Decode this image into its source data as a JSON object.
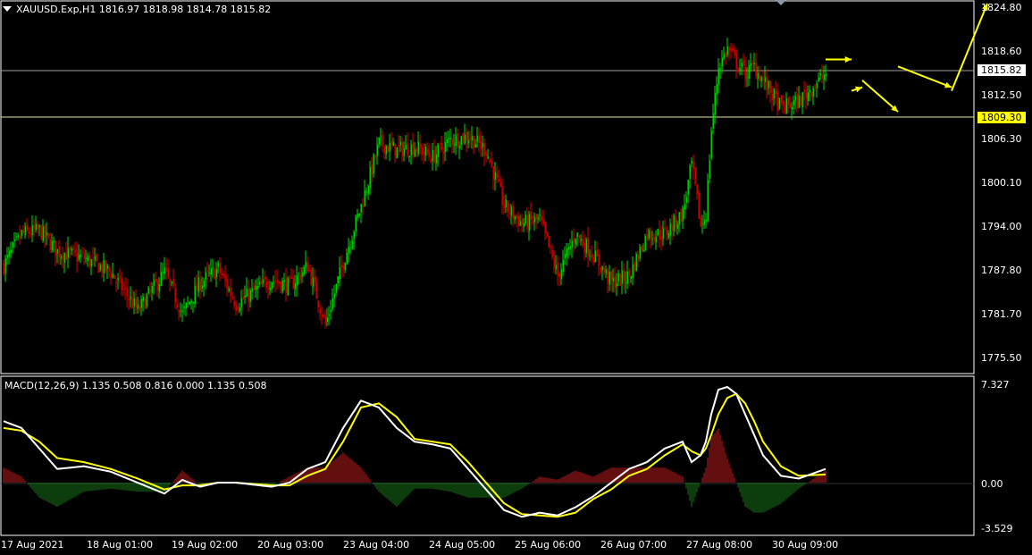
{
  "header": {
    "symbol": "XAUUSD.Exp,H1",
    "ohlc": "1816.97 1818.98 1814.78 1815.82",
    "title": "XAUUSD.Exp,H1  1816.97 1818.98 1814.78 1815.82"
  },
  "price_axis": {
    "ticks": [
      "1824.80",
      "1818.60",
      "1812.50",
      "1806.30",
      "1800.10",
      "1794.00",
      "1787.80",
      "1781.70",
      "1775.50"
    ],
    "current_price": "1815.82",
    "level_line": "1809.30"
  },
  "macd": {
    "title": "MACD(12,26,9) 1.135 0.508 0.816 0.000 1.135 0.508",
    "ticks": [
      "7.327",
      "0.00",
      "-3.529"
    ]
  },
  "time_axis": {
    "ticks": [
      "17 Aug 2021",
      "18 Aug 01:00",
      "19 Aug 02:00",
      "20 Aug 03:00",
      "23 Aug 04:00",
      "24 Aug 05:00",
      "25 Aug 06:00",
      "26 Aug 07:00",
      "27 Aug 08:00",
      "30 Aug 09:00"
    ]
  },
  "colors": {
    "background": "#000000",
    "bull": "#00e000",
    "bear": "#e00000",
    "grid_lines": "#ffffff",
    "forecast": "#ffff00",
    "macd_line": "#ffffff",
    "signal_line": "#ffff00",
    "histogram_up": "#c81e1e",
    "histogram_down": "#1a7a1a"
  },
  "chart_data": {
    "type": "candlestick",
    "symbol": "XAUUSD.Exp",
    "timeframe": "H1",
    "ylim": [
      1773.5,
      1826.0
    ],
    "price_anchors": [
      [
        0,
        1788.5
      ],
      [
        10,
        1793.0
      ],
      [
        20,
        1793.5
      ],
      [
        30,
        1790.5
      ],
      [
        45,
        1789.5
      ],
      [
        60,
        1787.5
      ],
      [
        75,
        1782.0
      ],
      [
        90,
        1787.5
      ],
      [
        100,
        1781.5
      ],
      [
        110,
        1786.0
      ],
      [
        120,
        1788.0
      ],
      [
        130,
        1783.0
      ],
      [
        150,
        1786.5
      ],
      [
        160,
        1785.5
      ],
      [
        170,
        1788.5
      ],
      [
        180,
        1780.0
      ],
      [
        190,
        1789.0
      ],
      [
        200,
        1797.0
      ],
      [
        210,
        1806.0
      ],
      [
        220,
        1805.0
      ],
      [
        230,
        1805.5
      ],
      [
        240,
        1804.0
      ],
      [
        250,
        1806.5
      ],
      [
        260,
        1807.0
      ],
      [
        270,
        1805.0
      ],
      [
        280,
        1797.0
      ],
      [
        290,
        1794.5
      ],
      [
        300,
        1795.0
      ],
      [
        310,
        1787.0
      ],
      [
        320,
        1793.0
      ],
      [
        330,
        1790.0
      ],
      [
        340,
        1786.0
      ],
      [
        350,
        1787.0
      ],
      [
        360,
        1793.0
      ],
      [
        370,
        1793.0
      ],
      [
        380,
        1796.0
      ],
      [
        385,
        1803.0
      ],
      [
        390,
        1794.0
      ],
      [
        393,
        1796.0
      ],
      [
        396,
        1808.0
      ],
      [
        400,
        1817.0
      ],
      [
        405,
        1819.5
      ],
      [
        410,
        1817.5
      ],
      [
        415,
        1816.0
      ],
      [
        420,
        1817.0
      ],
      [
        425,
        1815.0
      ],
      [
        435,
        1811.0
      ],
      [
        445,
        1812.0
      ],
      [
        460,
        1816.0
      ]
    ],
    "forecast_path": [
      [
        1818.0,
        1818.0
      ],
      [
        1813.5,
        1814.0
      ],
      [
        1815.0,
        1810.5
      ],
      [
        1817.0,
        1814.0
      ],
      [
        1813.5,
        1826.0
      ]
    ],
    "macd_anchors": [
      [
        0,
        4.5
      ],
      [
        10,
        4.0
      ],
      [
        20,
        2.5
      ],
      [
        30,
        1.0
      ],
      [
        45,
        1.2
      ],
      [
        60,
        0.8
      ],
      [
        75,
        0.0
      ],
      [
        90,
        -0.8
      ],
      [
        100,
        0.2
      ],
      [
        110,
        -0.3
      ],
      [
        120,
        0.0
      ],
      [
        130,
        0.0
      ],
      [
        150,
        -0.3
      ],
      [
        160,
        0.0
      ],
      [
        170,
        1.0
      ],
      [
        180,
        1.5
      ],
      [
        190,
        4.0
      ],
      [
        200,
        6.0
      ],
      [
        210,
        5.5
      ],
      [
        220,
        4.0
      ],
      [
        230,
        3.0
      ],
      [
        240,
        2.8
      ],
      [
        250,
        2.5
      ],
      [
        260,
        1.0
      ],
      [
        270,
        -0.5
      ],
      [
        280,
        -2.0
      ],
      [
        290,
        -2.5
      ],
      [
        300,
        -2.2
      ],
      [
        310,
        -2.4
      ],
      [
        320,
        -1.8
      ],
      [
        330,
        -1.0
      ],
      [
        340,
        0.0
      ],
      [
        350,
        1.0
      ],
      [
        360,
        1.5
      ],
      [
        370,
        2.5
      ],
      [
        380,
        3.0
      ],
      [
        385,
        1.5
      ],
      [
        390,
        2.0
      ],
      [
        393,
        3.0
      ],
      [
        396,
        5.0
      ],
      [
        400,
        6.8
      ],
      [
        405,
        7.0
      ],
      [
        410,
        6.5
      ],
      [
        415,
        5.0
      ],
      [
        420,
        3.5
      ],
      [
        425,
        2.0
      ],
      [
        435,
        0.5
      ],
      [
        445,
        0.3
      ],
      [
        460,
        1.0
      ]
    ],
    "signal_anchors": [
      [
        0,
        4.0
      ],
      [
        10,
        3.8
      ],
      [
        20,
        3.0
      ],
      [
        30,
        1.8
      ],
      [
        45,
        1.5
      ],
      [
        60,
        1.0
      ],
      [
        75,
        0.3
      ],
      [
        90,
        -0.5
      ],
      [
        100,
        -0.2
      ],
      [
        110,
        -0.2
      ],
      [
        120,
        0.0
      ],
      [
        130,
        0.0
      ],
      [
        150,
        -0.2
      ],
      [
        160,
        -0.2
      ],
      [
        170,
        0.5
      ],
      [
        180,
        1.0
      ],
      [
        190,
        3.0
      ],
      [
        200,
        5.5
      ],
      [
        210,
        5.8
      ],
      [
        220,
        4.8
      ],
      [
        230,
        3.2
      ],
      [
        240,
        3.0
      ],
      [
        250,
        2.8
      ],
      [
        260,
        1.5
      ],
      [
        270,
        0.0
      ],
      [
        280,
        -1.5
      ],
      [
        290,
        -2.3
      ],
      [
        300,
        -2.4
      ],
      [
        310,
        -2.5
      ],
      [
        320,
        -2.2
      ],
      [
        330,
        -1.2
      ],
      [
        340,
        -0.5
      ],
      [
        350,
        0.5
      ],
      [
        360,
        1.0
      ],
      [
        370,
        2.0
      ],
      [
        380,
        2.8
      ],
      [
        385,
        2.3
      ],
      [
        390,
        2.0
      ],
      [
        393,
        2.5
      ],
      [
        396,
        3.5
      ],
      [
        400,
        5.0
      ],
      [
        405,
        6.2
      ],
      [
        410,
        6.5
      ],
      [
        415,
        5.8
      ],
      [
        420,
        4.5
      ],
      [
        425,
        3.0
      ],
      [
        435,
        1.2
      ],
      [
        445,
        0.5
      ],
      [
        460,
        0.6
      ]
    ],
    "macd_ylim": [
      -3.529,
      7.327
    ]
  }
}
